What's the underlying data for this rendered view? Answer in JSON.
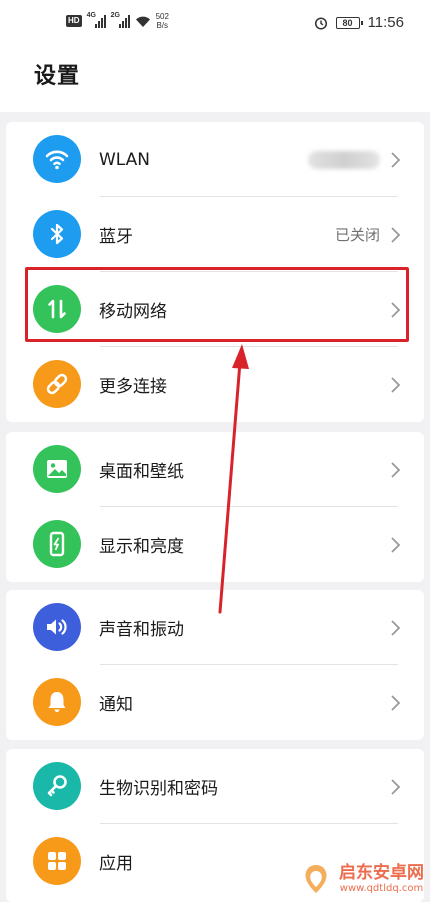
{
  "status_bar": {
    "hd": "HD",
    "signal1_gen": "4G",
    "signal2_gen": "2G",
    "speed_value": "502",
    "speed_unit": "B/s",
    "battery": "80",
    "time": "11:56"
  },
  "header": {
    "title": "设置"
  },
  "groups": [
    {
      "items": [
        {
          "label": "WLAN",
          "icon": "wifi-icon",
          "color": "#1e9df0"
        },
        {
          "label": "蓝牙",
          "value": "已关闭",
          "icon": "bluetooth-icon",
          "color": "#1e9df0"
        },
        {
          "label": "移动网络",
          "icon": "mobile-data-icon",
          "color": "#33c35a"
        },
        {
          "label": "更多连接",
          "icon": "link-icon",
          "color": "#f79a1a"
        }
      ]
    },
    {
      "items": [
        {
          "label": "桌面和壁纸",
          "icon": "wallpaper-icon",
          "color": "#33c35a"
        },
        {
          "label": "显示和亮度",
          "icon": "display-icon",
          "color": "#33c35a"
        }
      ]
    },
    {
      "items": [
        {
          "label": "声音和振动",
          "icon": "sound-icon",
          "color": "#3e5fdc"
        },
        {
          "label": "通知",
          "icon": "bell-icon",
          "color": "#f79a1a"
        }
      ]
    },
    {
      "items": [
        {
          "label": "生物识别和密码",
          "icon": "key-icon",
          "color": "#1ab8a8"
        },
        {
          "label": "应用",
          "icon": "apps-icon",
          "color": "#f79a1a"
        }
      ]
    }
  ],
  "annotation": {
    "highlight_color": "#d9232b"
  },
  "watermark": {
    "text": "启东安卓网",
    "url": "www.qdtldq.com"
  }
}
